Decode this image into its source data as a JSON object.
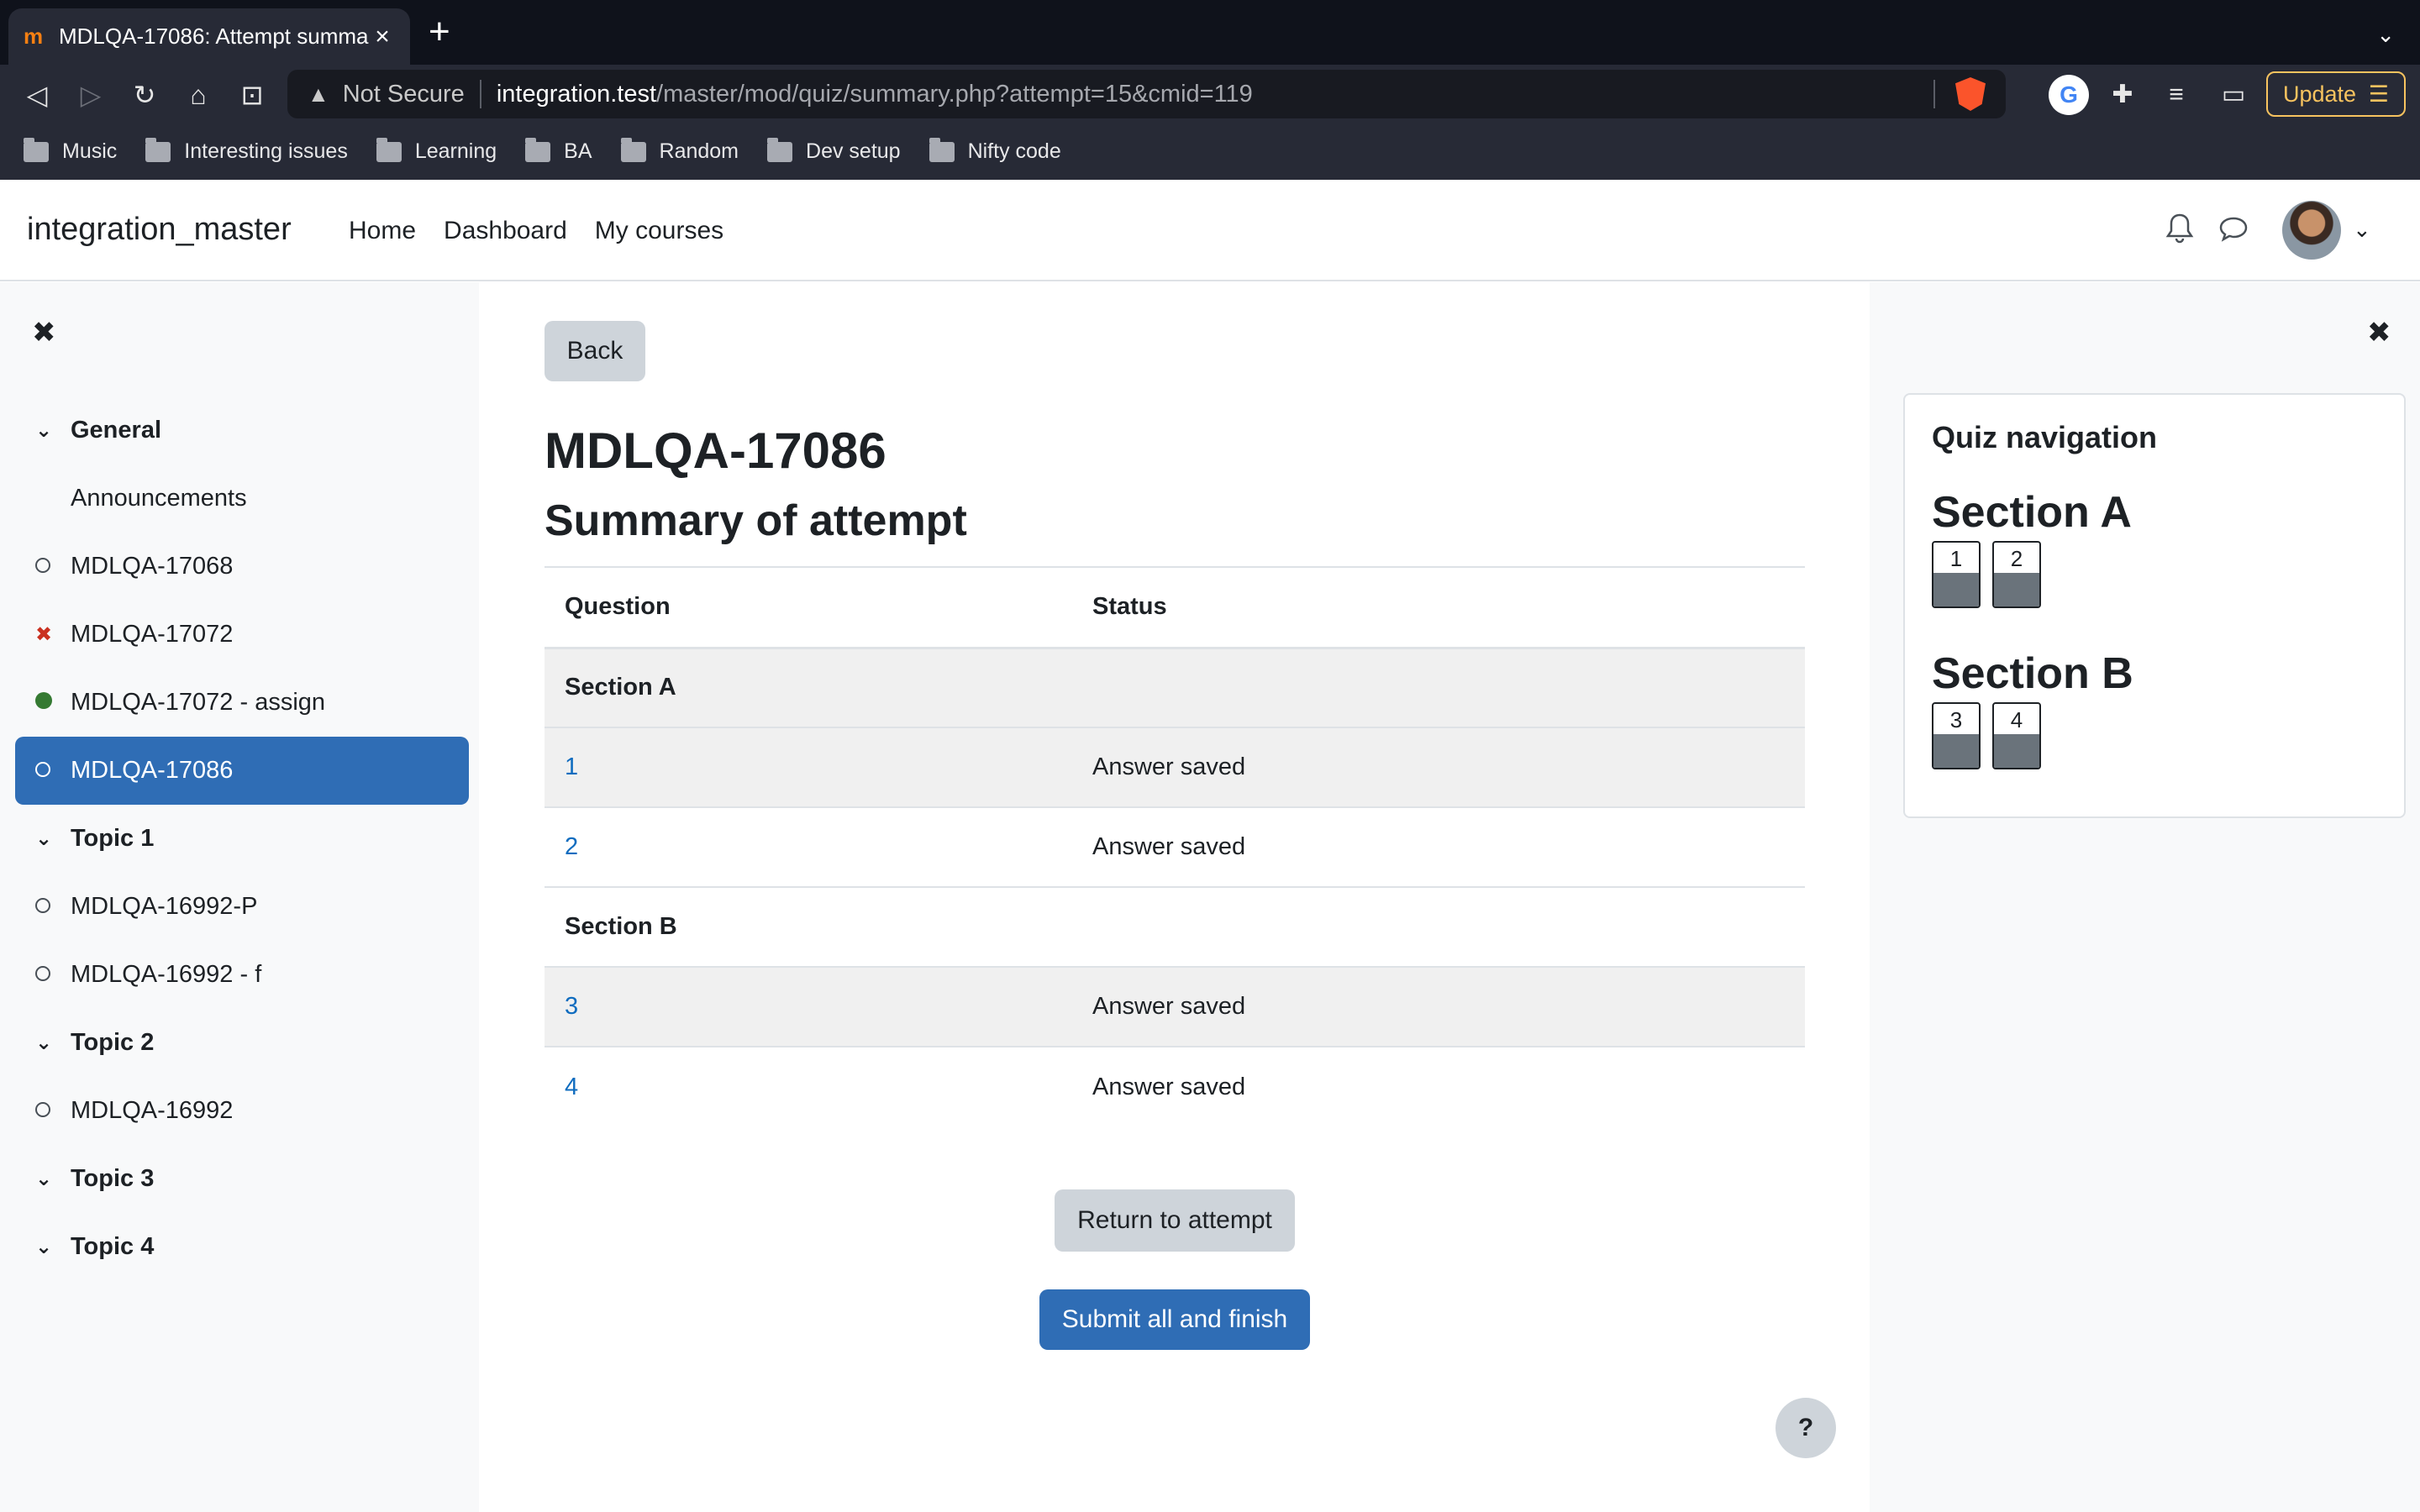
{
  "browser": {
    "tab_title": "MDLQA-17086: Attempt summa",
    "tab_close": "×",
    "new_tab": "+",
    "tab_list": "⌄",
    "url_warning": "Not Secure",
    "url_host": "integration.test",
    "url_path": "/master/mod/quiz/summary.php?attempt=15&cmid=119",
    "update_label": "Update",
    "update_menu": "☰",
    "bookmarks": [
      "Music",
      "Interesting issues",
      "Learning",
      "BA",
      "Random",
      "Dev setup",
      "Nifty code"
    ]
  },
  "navbar": {
    "brand": "integration_master",
    "links": [
      "Home",
      "Dashboard",
      "My courses"
    ]
  },
  "course_index": {
    "close": "✖",
    "items": [
      {
        "label": "General",
        "type": "section",
        "marker": "⌄"
      },
      {
        "label": "Announcements",
        "type": "child",
        "marker": ""
      },
      {
        "label": "MDLQA-17068",
        "type": "child",
        "marker": "circle"
      },
      {
        "label": "MDLQA-17072",
        "type": "child",
        "marker": "cross"
      },
      {
        "label": "MDLQA-17072 - assign",
        "type": "child",
        "marker": "dot"
      },
      {
        "label": "MDLQA-17086",
        "type": "child",
        "marker": "circle",
        "active": true
      },
      {
        "label": "Topic 1",
        "type": "section",
        "marker": "⌄"
      },
      {
        "label": "MDLQA-16992-P",
        "type": "child",
        "marker": "circle"
      },
      {
        "label": "MDLQA-16992 - f",
        "type": "child",
        "marker": "circle"
      },
      {
        "label": "Topic 2",
        "type": "section",
        "marker": "⌄"
      },
      {
        "label": "MDLQA-16992",
        "type": "child",
        "marker": "circle"
      },
      {
        "label": "Topic 3",
        "type": "section",
        "marker": "⌄"
      },
      {
        "label": "Topic 4",
        "type": "section",
        "marker": "⌄"
      }
    ]
  },
  "main": {
    "back_label": "Back",
    "title": "MDLQA-17086",
    "subtitle": "Summary of attempt",
    "table": {
      "headers": [
        "Question",
        "Status"
      ],
      "rows": [
        {
          "type": "section",
          "label": "Section A"
        },
        {
          "type": "question",
          "number": "1",
          "status": "Answer saved"
        },
        {
          "type": "question",
          "number": "2",
          "status": "Answer saved"
        },
        {
          "type": "section",
          "label": "Section B"
        },
        {
          "type": "question",
          "number": "3",
          "status": "Answer saved"
        },
        {
          "type": "question",
          "number": "4",
          "status": "Answer saved"
        }
      ]
    },
    "return_label": "Return to attempt",
    "submit_label": "Submit all and finish",
    "help_label": "?"
  },
  "quiz_nav": {
    "close": "✖",
    "title": "Quiz navigation",
    "sections": [
      {
        "name": "Section A",
        "questions": [
          "1",
          "2"
        ]
      },
      {
        "name": "Section B",
        "questions": [
          "3",
          "4"
        ]
      }
    ]
  },
  "colors": {
    "primary": "#2f6db5",
    "link": "#0f6cbf",
    "drawer_bg": "#f8f9fa",
    "browser_dark": "#0f121b"
  }
}
